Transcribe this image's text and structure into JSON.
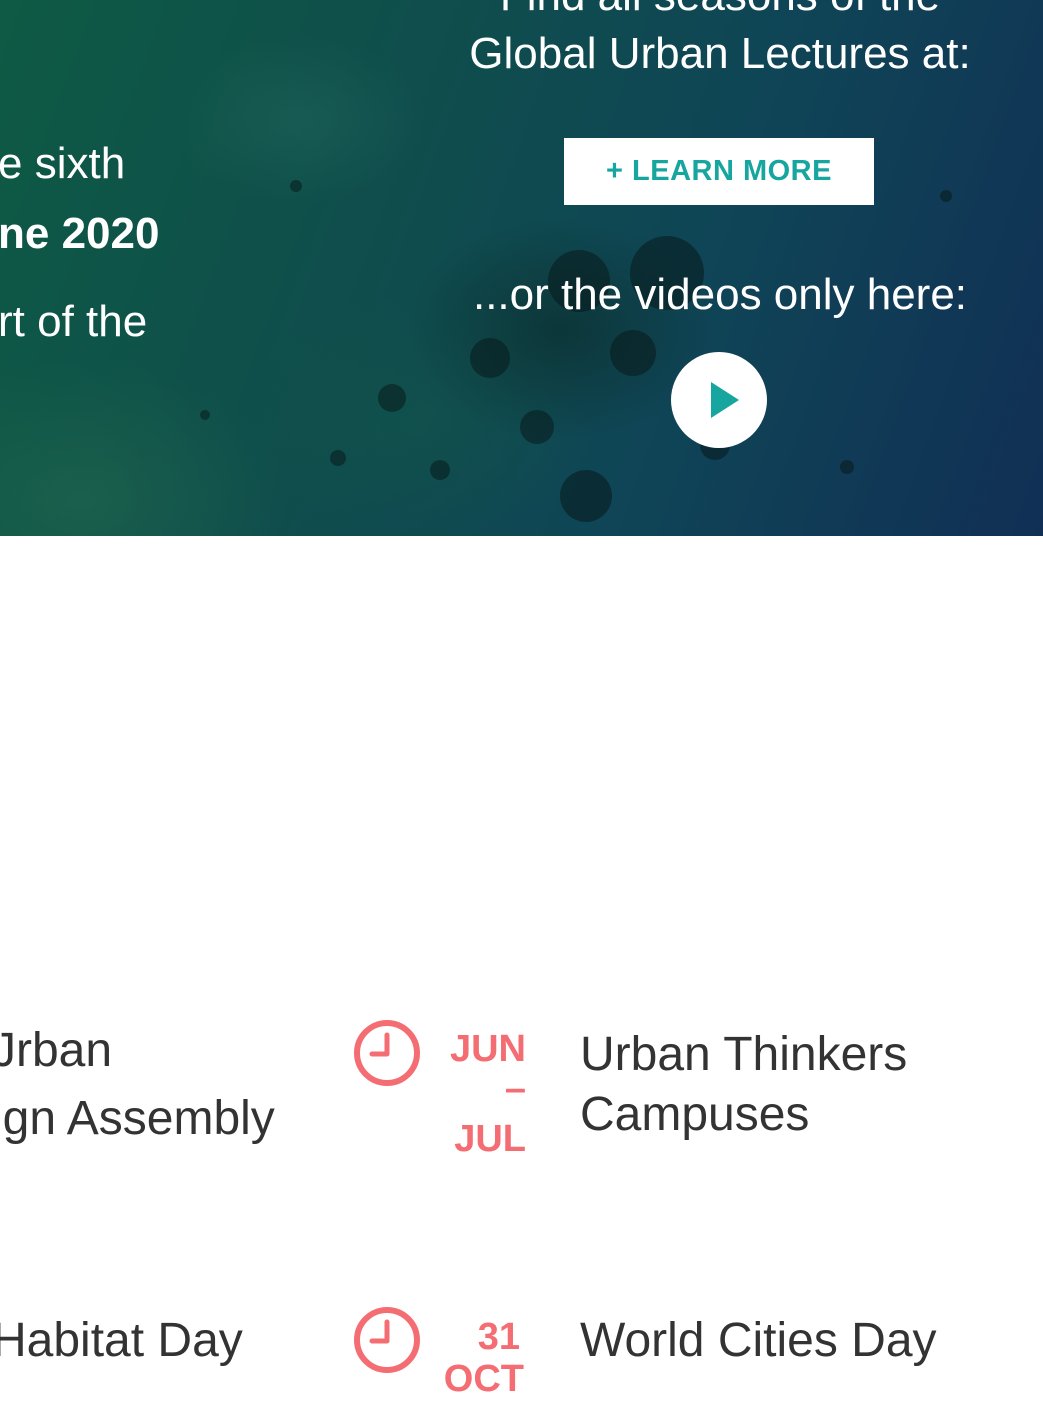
{
  "hero": {
    "left_line1": "e sixth",
    "left_line2": "ne 2020",
    "left_line3": "rt of the",
    "right_line1": "Find all seasons of the",
    "right_line2": "Global Urban Lectures at:",
    "learn_more_label": "+ LEARN MORE",
    "videos_text": "...or the videos only here:",
    "play_icon": "play-icon"
  },
  "events": {
    "left_col": [
      {
        "title_line1": "Jrban",
        "title_line2": "ign Assembly"
      },
      {
        "title_line1": "Habitat Day"
      }
    ],
    "right_col": [
      {
        "date_line1": "JUN",
        "date_sep": "–",
        "date_line2": "JUL",
        "title_line1": "Urban Thinkers",
        "title_line2": "Campuses",
        "icon": "clock-icon"
      },
      {
        "date_line1": "31",
        "date_line2": "OCT",
        "title_line1": "World Cities Day",
        "icon": "clock-icon"
      }
    ]
  },
  "colors": {
    "accent_teal": "#17a5a0",
    "date_red": "#f46d72",
    "text_dark": "#333333"
  }
}
